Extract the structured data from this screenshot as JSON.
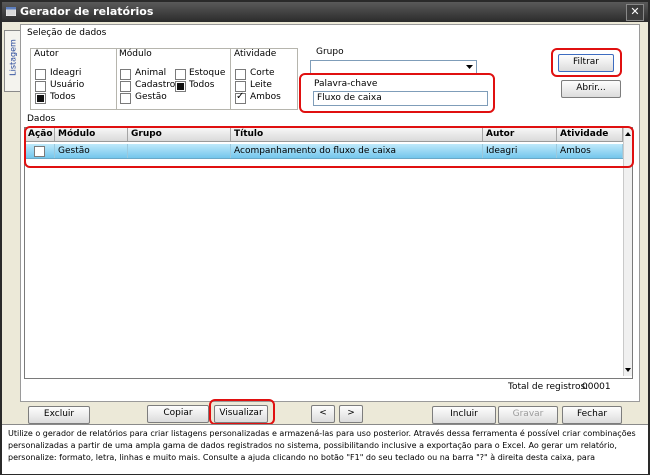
{
  "window": {
    "title": "Gerador de relatórios",
    "close_glyph": "✕"
  },
  "side_tab": {
    "label": "Listagem"
  },
  "selection": {
    "heading": "Seleção de dados",
    "autor": {
      "label": "Autor",
      "options": [
        {
          "label": "Ideagri",
          "state": "unchecked"
        },
        {
          "label": "Usuário",
          "state": "unchecked"
        },
        {
          "label": "Todos",
          "state": "filled"
        }
      ]
    },
    "modulo": {
      "label": "Módulo",
      "options": [
        {
          "label": "Animal",
          "state": "unchecked"
        },
        {
          "label": "Estoque",
          "state": "unchecked"
        },
        {
          "label": "Cadastro",
          "state": "unchecked"
        },
        {
          "label": "Todos",
          "state": "filled"
        },
        {
          "label": "Gestão",
          "state": "unchecked"
        }
      ]
    },
    "atividade": {
      "label": "Atividade",
      "options": [
        {
          "label": "Corte",
          "state": "unchecked"
        },
        {
          "label": "Leite",
          "state": "unchecked"
        },
        {
          "label": "Ambos",
          "state": "checked"
        }
      ]
    },
    "grupo": {
      "label": "Grupo",
      "value": ""
    },
    "palavra_chave": {
      "label": "Palavra-chave",
      "value": "Fluxo de caixa"
    },
    "filtrar_label": "Filtrar",
    "abrir_label": "Abrir..."
  },
  "dados": {
    "heading": "Dados",
    "columns": [
      "Ação",
      "Módulo",
      "Grupo",
      "Título",
      "Autor",
      "Atividade"
    ],
    "rows": [
      {
        "modulo": "Gestão",
        "grupo": "",
        "titulo": "Acompanhamento do fluxo de caixa",
        "autor": "Ideagri",
        "atividade": "Ambos"
      }
    ],
    "total_label": "Total de registros:",
    "total_value": "00001"
  },
  "buttons": {
    "excluir": "Excluir",
    "copiar": "Copiar",
    "visualizar": "Visualizar",
    "prev": "<",
    "next": ">",
    "incluir": "Incluir",
    "gravar": "Gravar",
    "fechar": "Fechar"
  },
  "help_text": "Utilize o gerador de relatórios para criar listagens personalizadas e armazená-las para uso posterior. Através dessa ferramenta é possível criar combinações personalizadas a partir de uma ampla gama de dados registrados no sistema, possibilitando inclusive a exportação para o Excel. Ao gerar um relatório, personalize: formato, letra, linhas e muito mais. Consulte a ajuda clicando no botão \"F1\" do seu teclado ou na barra \"?\" à direita desta caixa, para",
  "colors": {
    "highlight_red": "#e01010",
    "row_selected": "#74c6ec",
    "title_bar": "#2b2b2b",
    "window_bg": "#ece9d8"
  }
}
